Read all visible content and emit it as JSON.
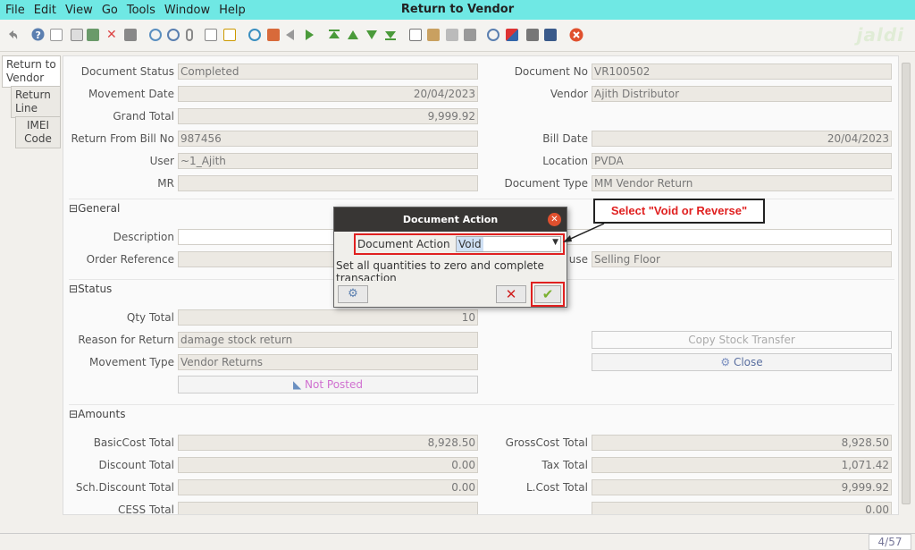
{
  "window": {
    "title": "Return to Vendor"
  },
  "menu": [
    "File",
    "Edit",
    "View",
    "Go",
    "Tools",
    "Window",
    "Help"
  ],
  "toolbar_icons": [
    "undo-icon",
    "help-icon",
    "new-icon",
    "copy-icon",
    "save-icon",
    "delete-icon",
    "save-all-icon",
    "refresh-icon",
    "find-icon",
    "attachment-icon",
    "chat-icon",
    "history-icon",
    "home-icon",
    "parent-icon",
    "back-icon",
    "forward-icon",
    "first-icon",
    "previous-icon",
    "next-icon",
    "last-icon",
    "report-icon",
    "archive-icon",
    "print-preview-icon",
    "print-icon",
    "zoom-icon",
    "workflow-icon",
    "product-icon",
    "request-icon",
    "close-window-icon"
  ],
  "logo": "jaldi",
  "tabs": [
    "Return to Vendor",
    "Return Line",
    "IMEI Code"
  ],
  "header": {
    "document_status": {
      "label": "Document Status",
      "value": "Completed"
    },
    "document_no": {
      "label": "Document No",
      "value": "VR100502"
    },
    "movement_date": {
      "label": "Movement Date",
      "value": "20/04/2023"
    },
    "vendor": {
      "label": "Vendor",
      "value": "Ajith Distributor"
    },
    "grand_total": {
      "label": "Grand Total",
      "value": "9,999.92"
    },
    "return_from_bill_no": {
      "label": "Return From Bill No",
      "value": "987456"
    },
    "bill_date": {
      "label": "Bill Date",
      "value": "20/04/2023"
    },
    "user": {
      "label": "User",
      "value": "~1_Ajith"
    },
    "location": {
      "label": "Location",
      "value": "PVDA"
    },
    "mr": {
      "label": "MR",
      "value": ""
    },
    "document_type": {
      "label": "Document Type",
      "value": "MM Vendor Return"
    }
  },
  "general": {
    "title": "General",
    "description_label": "Description",
    "order_reference_label": "Order Reference",
    "warehouse_label_tail": "use",
    "warehouse_value": "Selling Floor"
  },
  "status_section": {
    "title": "Status",
    "qty_total": {
      "label": "Qty Total",
      "value": "10"
    },
    "reason": {
      "label": "Reason for Return",
      "value": "damage stock return"
    },
    "movement_type": {
      "label": "Movement Type",
      "value": "Vendor Returns"
    },
    "copy_stock_transfer": "Copy Stock Transfer",
    "close_button": "Close",
    "posted_button": "Not Posted"
  },
  "amounts": {
    "title": "Amounts",
    "basic_cost_total": {
      "label": "BasicCost Total",
      "value": "8,928.50"
    },
    "gross_cost_total": {
      "label": "GrossCost Total",
      "value": "8,928.50"
    },
    "discount_total": {
      "label": "Discount Total",
      "value": "0.00"
    },
    "tax_total": {
      "label": "Tax Total",
      "value": "1,071.42"
    },
    "sch_discount_total": {
      "label": "Sch.Discount Total",
      "value": "0.00"
    },
    "l_cost_total": {
      "label": "L.Cost Total",
      "value": "9,999.92"
    },
    "cess_total": {
      "label": "CESS Total",
      "value": "0.00"
    }
  },
  "dialog": {
    "title": "Document Action",
    "field_label": "Document Action",
    "selected": "Void",
    "description": "Set all quantities to zero and complete transaction"
  },
  "callout": "Select \"Void or Reverse\"",
  "status_bar": {
    "pager": "4/57"
  },
  "colors": {
    "titlebar": "#6fe8e4",
    "highlight": "#e02020",
    "dialog_header": "#383634"
  }
}
